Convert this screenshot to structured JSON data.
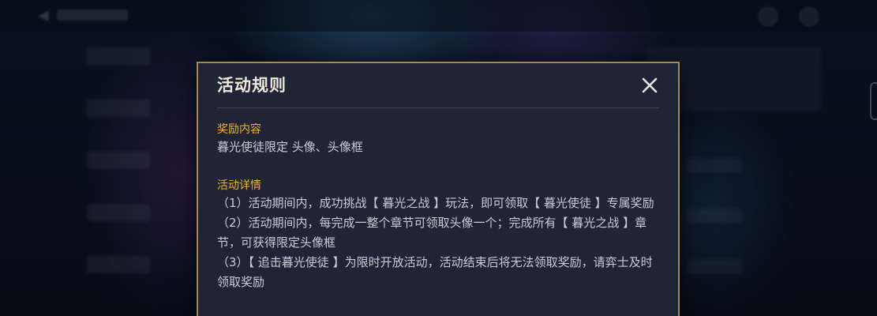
{
  "modal": {
    "title": "活动规则",
    "close_icon": "close-icon",
    "sections": [
      {
        "heading": "奖励内容",
        "lines": [
          "暮光使徒限定 头像、头像框"
        ]
      },
      {
        "heading": "活动详情",
        "lines": [
          "（1）活动期间内，成功挑战【 暮光之战 】玩法，即可领取【 暮光使徒 】专属奖励",
          "（2）活动期间内，每完成一整个章节可领取头像一个；完成所有【 暮光之战 】章节，可获得限定头像框",
          "（3）【 追击暮光使徒 】为限时开放活动，活动结束后将无法领取奖励，请弈士及时领取奖励"
        ]
      }
    ]
  },
  "colors": {
    "accent_gold": "#f2b324",
    "modal_border": "#a58a52",
    "modal_bg": "#1f2535",
    "title_text": "#ece8de",
    "body_text": "#c9ccd4"
  }
}
